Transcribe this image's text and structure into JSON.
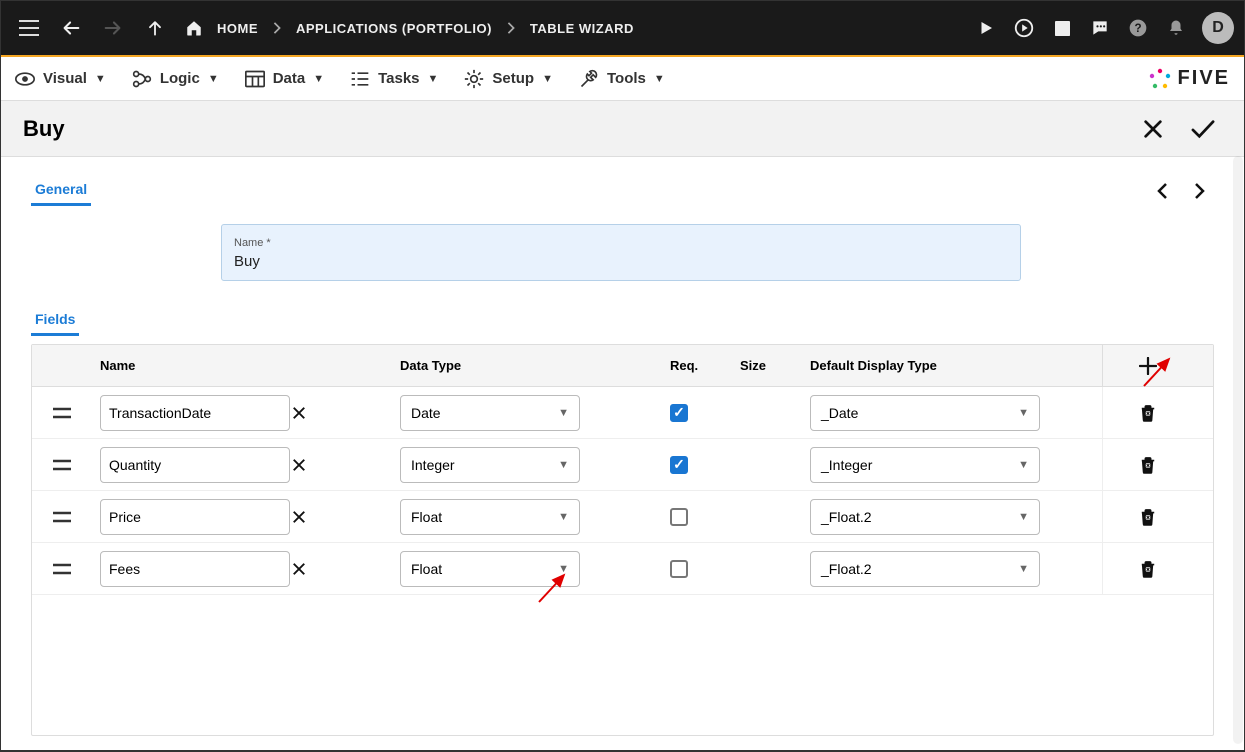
{
  "topbar": {
    "breadcrumb": [
      {
        "label": "HOME"
      },
      {
        "label": "APPLICATIONS (PORTFOLIO)"
      },
      {
        "label": "TABLE WIZARD"
      }
    ],
    "avatar": "D"
  },
  "brand": "FIVE",
  "menu": [
    {
      "label": "Visual"
    },
    {
      "label": "Logic"
    },
    {
      "label": "Data"
    },
    {
      "label": "Tasks"
    },
    {
      "label": "Setup"
    },
    {
      "label": "Tools"
    }
  ],
  "title": "Buy",
  "tabs": {
    "general": "General",
    "fields": "Fields"
  },
  "nameField": {
    "label": "Name *",
    "value": "Buy"
  },
  "gridHeaders": {
    "name": "Name",
    "dataType": "Data Type",
    "req": "Req.",
    "size": "Size",
    "displayType": "Default Display Type"
  },
  "rows": [
    {
      "name": "TransactionDate",
      "dataType": "Date",
      "req": true,
      "size": "",
      "displayType": "_Date"
    },
    {
      "name": "Quantity",
      "dataType": "Integer",
      "req": true,
      "size": "",
      "displayType": "_Integer"
    },
    {
      "name": "Price",
      "dataType": "Float",
      "req": false,
      "size": "",
      "displayType": "_Float.2"
    },
    {
      "name": "Fees",
      "dataType": "Float",
      "req": false,
      "size": "",
      "displayType": "_Float.2"
    }
  ]
}
